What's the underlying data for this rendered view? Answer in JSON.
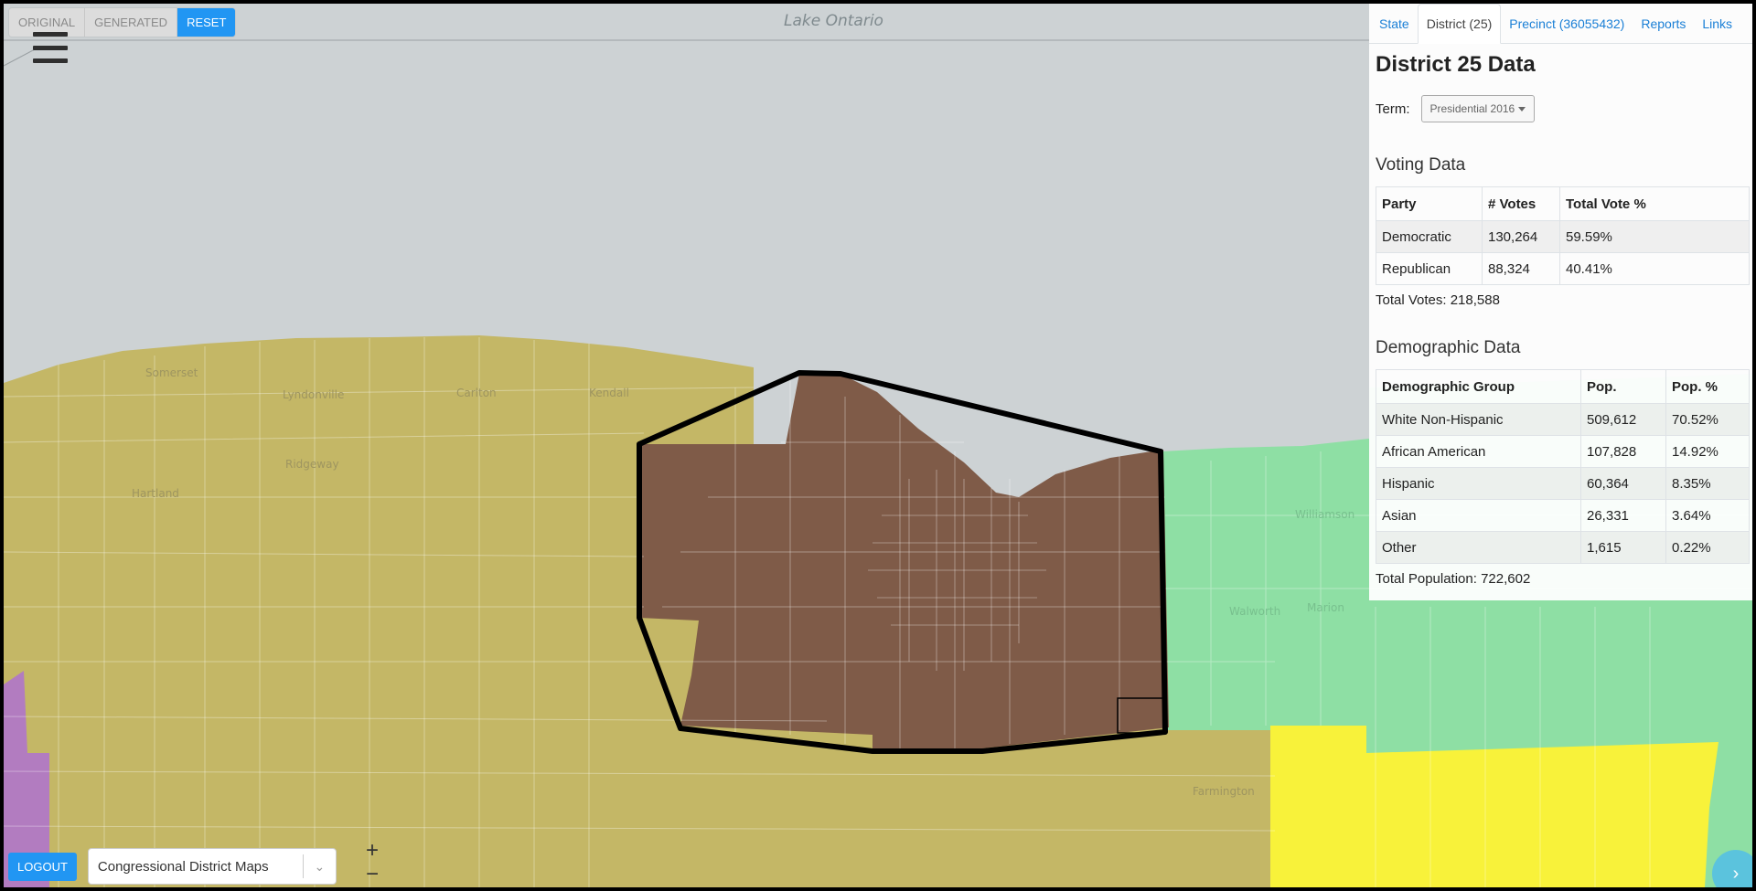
{
  "map": {
    "lake_label": "Lake Ontario",
    "colors": {
      "water": "#cdd2d4",
      "district_tan": "#c4b766",
      "district_brown": "#7f5b48",
      "district_green": "#8edfa4",
      "district_yellow": "#f8f23a",
      "district_purple": "#b27cc0"
    },
    "place_labels": [
      "Somerset",
      "Lyndonville",
      "Carlton",
      "Kendall",
      "Ridgeway",
      "Hartland",
      "Williamson",
      "Walworth",
      "Marion",
      "Farmington"
    ]
  },
  "mode_buttons": [
    "ORIGINAL",
    "GENERATED",
    "RESET"
  ],
  "menu": {
    "icon": "hamburger-icon"
  },
  "tabs": [
    "State",
    "District (25)",
    "Precinct (36055432)",
    "Reports",
    "Links"
  ],
  "panel": {
    "title": "District 25 Data",
    "term_label": "Term:",
    "term_value": "Presidential 2016",
    "voting": {
      "heading": "Voting Data",
      "columns": [
        "Party",
        "# Votes",
        "Total Vote %"
      ],
      "rows": [
        [
          "Democratic",
          "130,264",
          "59.59%"
        ],
        [
          "Republican",
          "88,324",
          "40.41%"
        ]
      ],
      "total": "Total Votes: 218,588"
    },
    "demographic": {
      "heading": "Demographic Data",
      "columns": [
        "Demographic Group",
        "Pop.",
        "Pop. %"
      ],
      "rows": [
        [
          "White Non-Hispanic",
          "509,612",
          "70.52%"
        ],
        [
          "African American",
          "107,828",
          "14.92%"
        ],
        [
          "Hispanic",
          "60,364",
          "8.35%"
        ],
        [
          "Asian",
          "26,331",
          "3.64%"
        ],
        [
          "Other",
          "1,615",
          "0.22%"
        ]
      ],
      "total": "Total Population: 722,602"
    }
  },
  "bottom": {
    "logout": "LOGOUT",
    "map_select": "Congressional District Maps",
    "zoom_in": "+",
    "zoom_out": "−"
  },
  "corner_button": "›"
}
